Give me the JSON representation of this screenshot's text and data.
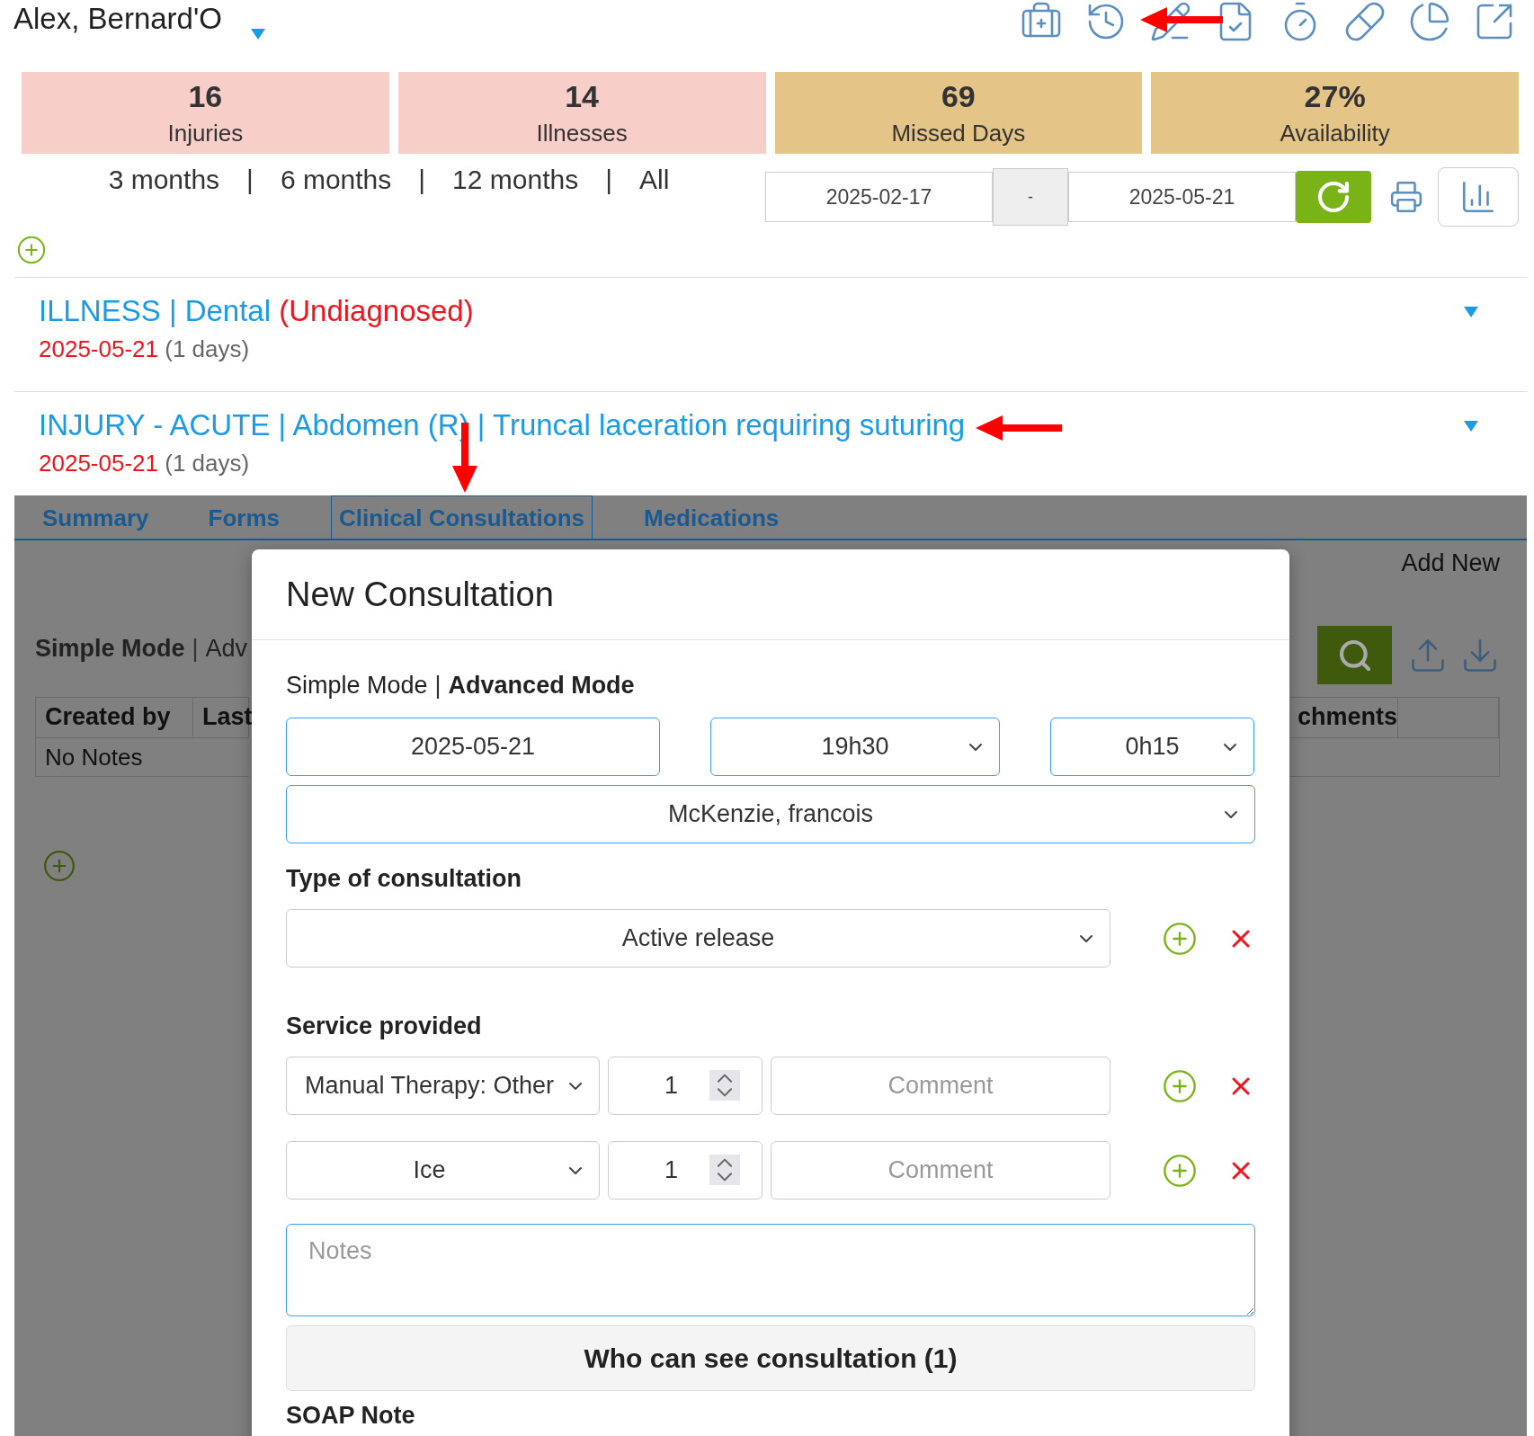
{
  "patient": {
    "name": "Alex, Bernard'O"
  },
  "stats": [
    {
      "value": "16",
      "label": "Injuries",
      "color": "#f8cfc8"
    },
    {
      "value": "14",
      "label": "Illnesses",
      "color": "#f8cfc8"
    },
    {
      "value": "69",
      "label": "Missed Days",
      "color": "#e5c487"
    },
    {
      "value": "27%",
      "label": "Availability",
      "color": "#e5c487"
    }
  ],
  "periods": [
    "3 months",
    "6 months",
    "12 months",
    "All"
  ],
  "period_separator": "|",
  "date_range": {
    "from": "2025-02-17",
    "separator": "-",
    "to": "2025-05-21"
  },
  "records": [
    {
      "title": "ILLNESS | Dental",
      "status": "(Undiagnosed)",
      "date": "2025-05-21",
      "duration": "(1 days)"
    },
    {
      "title": "INJURY - ACUTE | Abdomen (R) | Truncal laceration requiring suturing",
      "date": "2025-05-21",
      "duration": "(1 days)"
    }
  ],
  "tabs": [
    {
      "label": "Summary",
      "selected": false
    },
    {
      "label": "Forms",
      "selected": false
    },
    {
      "label": "Clinical Consultations",
      "selected": true
    },
    {
      "label": "Medications",
      "selected": false
    }
  ],
  "background_panel": {
    "add_new": "Add New",
    "modes": [
      {
        "label": "Simple Mode",
        "selected": true
      },
      {
        "label": "Adv",
        "selected": false
      }
    ],
    "mode_separator": "|",
    "columns_left": [
      "Created by",
      "Last"
    ],
    "columns_right": [
      "chments"
    ],
    "empty_message": "No Notes"
  },
  "modal": {
    "title": "New Consultation",
    "modes": [
      {
        "label": "Simple Mode",
        "selected": false
      },
      {
        "label": "Advanced Mode",
        "selected": true
      }
    ],
    "mode_separator": "|",
    "date": "2025-05-21",
    "time": "19h30",
    "duration": "0h15",
    "clinician": "McKenzie, francois",
    "type_label": "Type of consultation",
    "type_value": "Active release",
    "service_label": "Service provided",
    "services": [
      {
        "service": "Manual Therapy: Other",
        "quantity": "1",
        "comment_placeholder": "Comment"
      },
      {
        "service": "Ice",
        "quantity": "1",
        "comment_placeholder": "Comment"
      }
    ],
    "notes_placeholder": "Notes",
    "visibility_button": "Who can see consultation (1)",
    "next_section": "SOAP Note"
  }
}
